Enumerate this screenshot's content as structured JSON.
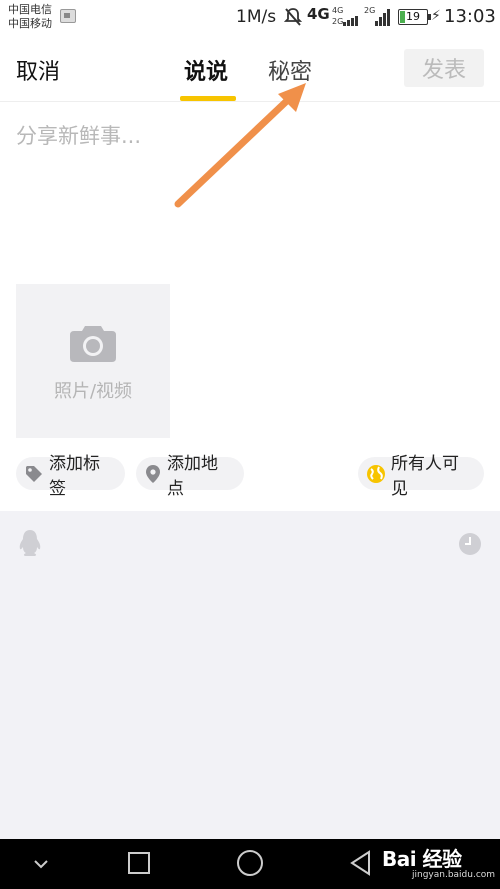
{
  "status_bar": {
    "carrier_1": "中国电信",
    "carrier_2": "中国移动",
    "net_speed": "1M/s",
    "network_type": "4G",
    "signal_1_label": "4G",
    "signal_2_label": "2G",
    "signal_3_label": "2G",
    "battery_level": "19",
    "battery_fraction": 0.19,
    "time": "13:03"
  },
  "header": {
    "cancel_label": "取消",
    "tabs": [
      {
        "label": "说说",
        "active": true
      },
      {
        "label": "秘密",
        "active": false
      }
    ],
    "publish_label": "发表"
  },
  "compose": {
    "placeholder": "分享新鲜事...",
    "value": ""
  },
  "media": {
    "label": "照片/视频",
    "icon": "camera-icon"
  },
  "chips": {
    "tag_label": "添加标签",
    "tag_icon": "tag-icon",
    "location_label": "添加地点",
    "location_icon": "location-pin-icon",
    "visibility_label": "所有人可见",
    "visibility_icon": "globe-icon"
  },
  "lower_panel": {
    "left_icon": "penguin-icon",
    "right_icon": "clock-icon"
  },
  "nav_bar": {
    "watermark_main": "Bai 经验",
    "watermark_sub": "jingyan.baidu.com"
  },
  "colors": {
    "accent": "#f7c400",
    "arrow": "#f0904a",
    "battery_fill": "#4cb050",
    "visibility_globe": "#f7c400"
  }
}
